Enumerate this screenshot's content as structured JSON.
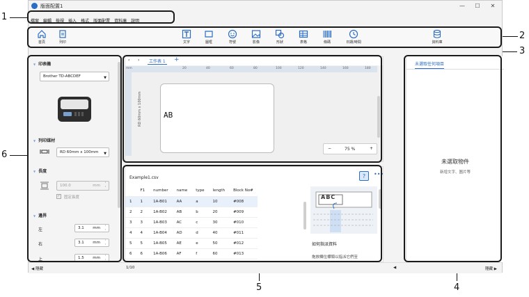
{
  "window": {
    "title": "版面配置1"
  },
  "menu": [
    "檔案",
    "編輯",
    "檢視",
    "插入",
    "格式",
    "版面配置",
    "資料庫",
    "說明"
  ],
  "ribbon": {
    "home": "首頁",
    "print": "列印",
    "text": "文字",
    "frame": "圖框",
    "symbol": "符號",
    "image": "影像",
    "shape": "形狀",
    "table": "表格",
    "barcode": "條碼",
    "datetime": "日期/時間",
    "database": "資料庫"
  },
  "left_panel": {
    "printer_header": "印表機",
    "printer_value": "Brother TD-ABCDEF",
    "media_header": "列印媒材",
    "media_value": "RD 60mm x 100mm",
    "length_header": "長度",
    "length_value": "100.0",
    "length_unit": "mm",
    "fixed_length_label": "固定長度",
    "margin_header": "邊界",
    "margin_left_label": "左",
    "margin_left_value": "3.1",
    "margin_right_label": "右",
    "margin_right_value": "3.1",
    "margin_top_label": "上",
    "margin_top_value": "1.5",
    "unit": "mm"
  },
  "canvas": {
    "tab": "工作表 1",
    "ruler_unit": "mm",
    "ruler_ticks": [
      "20",
      "40",
      "60",
      "80",
      "100",
      "120",
      "140",
      "160",
      "180"
    ],
    "side_label": "RD 60mm x 100mm",
    "label_text": "AB",
    "zoom": "75 %"
  },
  "database": {
    "file": "Example1.csv",
    "columns": [
      "",
      "F1",
      "number",
      "name",
      "type",
      "length",
      "Block No#"
    ],
    "rows": [
      [
        "1",
        "1",
        "1A-B01",
        "AA",
        "a",
        "10",
        "#008"
      ],
      [
        "2",
        "2",
        "1A-B02",
        "AB",
        "b",
        "20",
        "#009"
      ],
      [
        "3",
        "3",
        "1A-B03",
        "AC",
        "c",
        "30",
        "#010"
      ],
      [
        "4",
        "4",
        "1A-B04",
        "AD",
        "d",
        "40",
        "#011"
      ],
      [
        "5",
        "5",
        "1A-B05",
        "AE",
        "e",
        "50",
        "#012"
      ],
      [
        "6",
        "6",
        "1A-B06",
        "AF",
        "f",
        "60",
        "#013"
      ]
    ],
    "help_abc": "ABC",
    "help_title": "如何指派資料",
    "help_text": "拖放欄位標頭以指派它們至"
  },
  "properties": {
    "tab": "未選取任何項目",
    "empty_title": "未選取物件",
    "empty_sub": "新增文字、圖片等"
  },
  "status": {
    "left_hide": "隱藏",
    "page": "1/10",
    "right_hide": "隱藏"
  },
  "callouts": [
    "1",
    "2",
    "3",
    "4",
    "5",
    "6"
  ]
}
